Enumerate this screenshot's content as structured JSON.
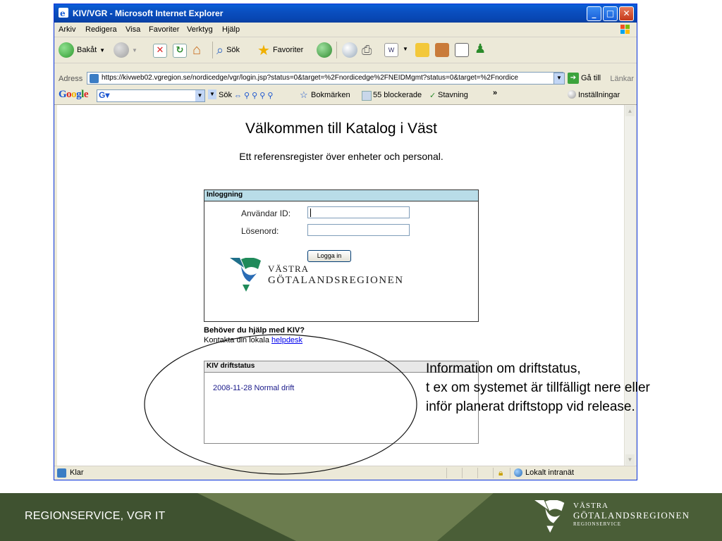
{
  "window": {
    "title": "KIV/VGR - Microsoft Internet Explorer",
    "minimize": "_",
    "maximize": "□",
    "close": "✕"
  },
  "menu": [
    "Arkiv",
    "Redigera",
    "Visa",
    "Favoriter",
    "Verktyg",
    "Hjälp"
  ],
  "toolbar": {
    "back": "Bakåt",
    "search": "Sök",
    "favorites": "Favoriter"
  },
  "address": {
    "label": "Adress",
    "url": "https://kivweb02.vgregion.se/nordicedge/vgr/login.jsp?status=0&target=%2Fnordicedge%2FNEIDMgmt?status=0&target=%2Fnordice",
    "go": "Gå till",
    "links": "Länkar"
  },
  "googlebar": {
    "logo": "Google",
    "search": "Sök",
    "bookmarks": "Bokmärken",
    "blocked": "55 blockerade",
    "spelling": "Stavning",
    "more": "»",
    "settings": "Inställningar"
  },
  "page": {
    "heading": "Välkommen till Katalog i Väst",
    "subheading": "Ett referensregister över enheter och personal.",
    "login": {
      "header": "Inloggning",
      "user_label": "Användar ID:",
      "password_label": "Lösenord:",
      "button": "Logga in"
    },
    "logo": {
      "line1": "VÄSTRA",
      "line2": "GÖTALANDSREGIONEN"
    },
    "help": {
      "title": "Behöver du hjälp med KIV?",
      "text_prefix": "Kontakta din lokala ",
      "link": "helpdesk"
    },
    "status": {
      "header": "KIV driftstatus",
      "entry": "2008-11-28 Normal drift"
    }
  },
  "statusbar": {
    "left": "Klar",
    "zone": "Lokalt intranät"
  },
  "annotation": {
    "line1": "Information om driftstatus,",
    "line2": "t ex om systemet är tillfälligt nere eller",
    "line3": "inför planerat driftstopp vid release."
  },
  "footer": {
    "label": "REGIONSERVICE, VGR IT",
    "logo_line1": "VÄSTRA",
    "logo_line2": "GÖTALANDSREGIONEN",
    "logo_line3": "REGIONSERVICE"
  },
  "colors": {
    "titlebar": "#0a4fc0",
    "panel_header": "#b9dde8",
    "footer_dark": "#3f5230",
    "footer_light": "#6b7c4e",
    "logo_blue": "#2a6cb5",
    "logo_green": "#1f8a5a"
  }
}
